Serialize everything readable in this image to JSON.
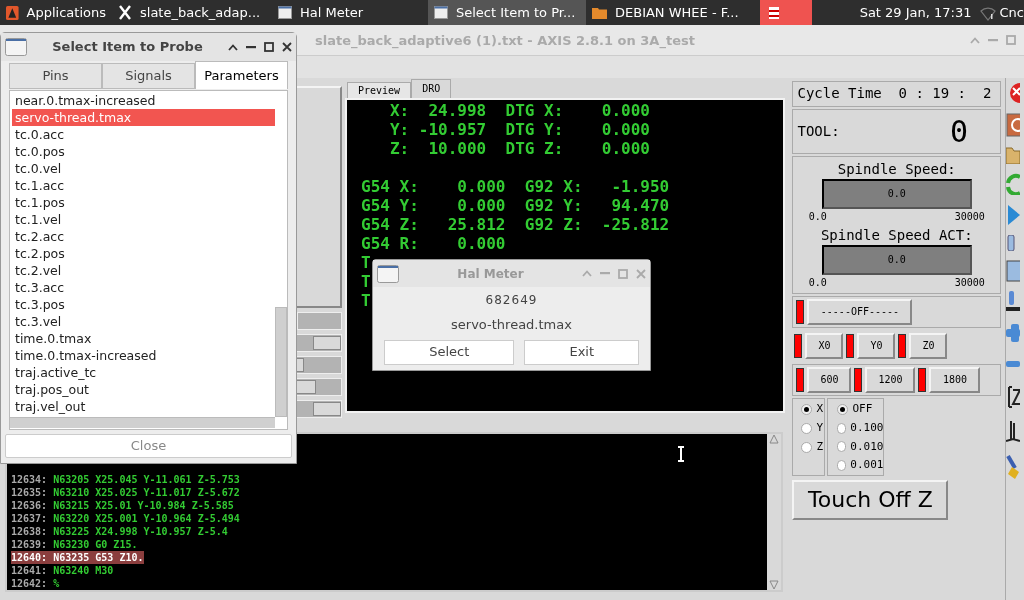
{
  "taskbar": {
    "items": [
      {
        "label": "Applications",
        "kind": "menu",
        "selected": false
      },
      {
        "label": "slate_back_adap...",
        "kind": "x",
        "selected": false
      },
      {
        "label": "Hal Meter",
        "kind": "window",
        "selected": false
      },
      {
        "label": "Select Item to Pr...",
        "kind": "window",
        "selected": true
      },
      {
        "label": "DEBIAN WHEE - F...",
        "kind": "folder",
        "selected": false
      },
      {
        "kind": "app",
        "selected": false
      }
    ],
    "clock": "Sat 29 Jan, 17:31",
    "user": "Cnc"
  },
  "axis": {
    "title": "slate_back_adaptive6 (1).txt - AXIS 2.8.1 on 3A_test",
    "tabs": [
      {
        "label": "Preview",
        "selected": false
      },
      {
        "label": "DRO",
        "selected": true
      }
    ],
    "sliders": [
      {
        "level": 1
      },
      {
        "level": 0.88
      },
      {
        "level": 0.92
      },
      {
        "level": 1
      }
    ],
    "dro_position": [
      "   X:  24.998  DTG X:    0.000",
      "   Y: -10.957  DTG Y:    0.000",
      "   Z:  10.000  DTG Z:    0.000"
    ],
    "dro_offsets": [
      "G54 X:    0.000  G92 X:   -1.950",
      "G54 Y:    0.000  G92 Y:   94.470",
      "G54 Z:   25.812  G92 Z:  -25.812",
      "G54 R:    0.000",
      "T",
      "T",
      "T"
    ],
    "gcode": [
      {
        "num": "12634:",
        "code": "N63205 X25.045 Y-11.061 Z-5.753",
        "selected": false
      },
      {
        "num": "12635:",
        "code": "N63210 X25.025 Y-11.017 Z-5.672",
        "selected": false
      },
      {
        "num": "12636:",
        "code": "N63215 X25.01 Y-10.984 Z-5.585",
        "selected": false
      },
      {
        "num": "12637:",
        "code": "N63220 X25.001 Y-10.964 Z-5.494",
        "selected": false
      },
      {
        "num": "12638:",
        "code": "N63225 X24.998 Y-10.957 Z-5.4",
        "selected": false
      },
      {
        "num": "12639:",
        "code": "N63230 G0 Z15.",
        "selected": false
      },
      {
        "num": "12640:",
        "code": "N63235 G53 Z10.",
        "selected": true
      },
      {
        "num": "12641:",
        "code": "N63240 M30",
        "selected": false
      },
      {
        "num": "12642:",
        "code": "%",
        "selected": false
      }
    ]
  },
  "panel": {
    "cycle_time": "Cycle Time  0 : 19 :  2",
    "tool_label": "TOOL:",
    "tool_value": "0",
    "meters": [
      {
        "label": "Spindle Speed:",
        "reading": "0.0",
        "min": "0.0",
        "max": "30000"
      },
      {
        "label": "Spindle Speed ACT:",
        "reading": "0.0",
        "min": "0.0",
        "max": "30000"
      }
    ],
    "button_rows": [
      [
        {
          "label": "-----OFF-----",
          "led_on": false
        }
      ],
      [
        {
          "label": "X0",
          "led_on": false
        },
        {
          "label": "Y0",
          "led_on": false
        },
        {
          "label": "Z0",
          "led_on": false
        }
      ],
      [
        {
          "label": "600",
          "led_on": false
        },
        {
          "label": "1200",
          "led_on": false
        },
        {
          "label": "1800",
          "led_on": false
        }
      ]
    ],
    "axes": [
      {
        "label": "X",
        "selected": true
      },
      {
        "label": "Y",
        "selected": false
      },
      {
        "label": "Z",
        "selected": false
      }
    ],
    "increments": [
      {
        "label": "OFF",
        "selected": true
      },
      {
        "label": "0.100",
        "selected": false
      },
      {
        "label": "0.010",
        "selected": false
      },
      {
        "label": "0.001",
        "selected": false
      }
    ],
    "touch_off": "Touch Off Z"
  },
  "probe": {
    "title": "Select Item to Probe",
    "tabs": [
      {
        "label": "Pins",
        "selected": false
      },
      {
        "label": "Signals",
        "selected": false
      },
      {
        "label": "Parameters",
        "selected": true
      }
    ],
    "items": [
      {
        "label": "near.0.tmax-increased",
        "selected": false
      },
      {
        "label": "servo-thread.tmax",
        "selected": true
      },
      {
        "label": "tc.0.acc",
        "selected": false
      },
      {
        "label": "tc.0.pos",
        "selected": false
      },
      {
        "label": "tc.0.vel",
        "selected": false
      },
      {
        "label": "tc.1.acc",
        "selected": false
      },
      {
        "label": "tc.1.pos",
        "selected": false
      },
      {
        "label": "tc.1.vel",
        "selected": false
      },
      {
        "label": "tc.2.acc",
        "selected": false
      },
      {
        "label": "tc.2.pos",
        "selected": false
      },
      {
        "label": "tc.2.vel",
        "selected": false
      },
      {
        "label": "tc.3.acc",
        "selected": false
      },
      {
        "label": "tc.3.pos",
        "selected": false
      },
      {
        "label": "tc.3.vel",
        "selected": false
      },
      {
        "label": "time.0.tmax",
        "selected": false
      },
      {
        "label": "time.0.tmax-increased",
        "selected": false
      },
      {
        "label": "traj.active_tc",
        "selected": false
      },
      {
        "label": "traj.pos_out",
        "selected": false
      },
      {
        "label": "traj.vel_out",
        "selected": false
      }
    ],
    "close": "Close"
  },
  "meter": {
    "title": "Hal Meter",
    "value": "682649",
    "name": "servo-thread.tmax",
    "buttons": [
      "Select",
      "Exit"
    ]
  }
}
